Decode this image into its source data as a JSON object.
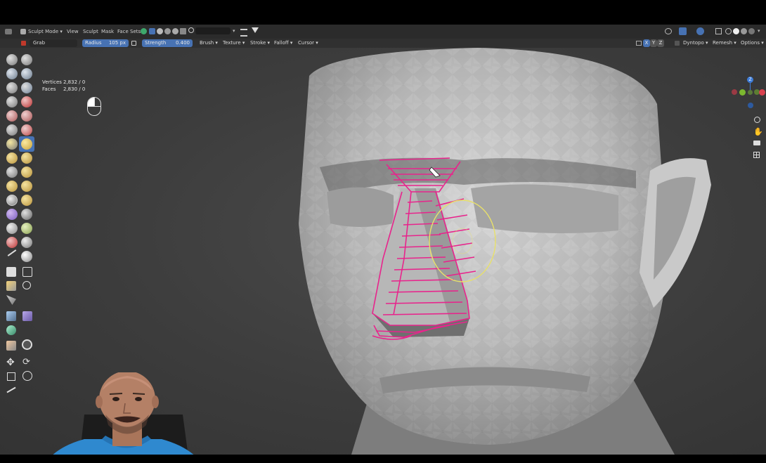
{
  "header": {
    "editor_menu": "Sculpt Mode",
    "menus": [
      "View",
      "Sculpt",
      "Mask",
      "Face Sets"
    ]
  },
  "tool_settings": {
    "brush_name": "Grab",
    "radius_label": "Radius",
    "radius_value": "105 px",
    "strength_label": "Strength",
    "strength_value": "0.400",
    "dropdowns": [
      "Brush",
      "Texture",
      "Stroke",
      "Falloff",
      "Cursor"
    ],
    "axis_x": "X",
    "axis_y": "Y",
    "axis_z": "Z",
    "dyntopo": "Dyntopo",
    "remesh": "Remesh",
    "options": "Options"
  },
  "stats": {
    "vertices_label": "Vertices",
    "vertices_value": "2,832 / 0",
    "faces_label": "Faces",
    "faces_value": "2,830 / 0"
  },
  "gizmo": {
    "z_label": "Z"
  },
  "colors": {
    "active_blue": "#4772b3",
    "stroke_pink": "#e8248c",
    "brush_circle": "#e8e06a",
    "axis_x": "#d9414f",
    "axis_y": "#7cb82f",
    "axis_z": "#3d7cd8"
  }
}
